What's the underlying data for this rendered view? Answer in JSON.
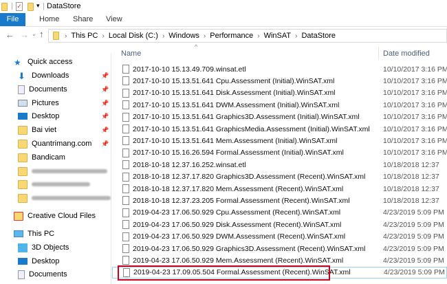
{
  "window": {
    "title": "DataStore"
  },
  "ribbon": {
    "tabs": [
      "File",
      "Home",
      "Share",
      "View"
    ]
  },
  "address": {
    "crumbs": [
      "This PC",
      "Local Disk (C:)",
      "Windows",
      "Performance",
      "WinSAT",
      "DataStore"
    ]
  },
  "columns": {
    "name": "Name",
    "date": "Date modified"
  },
  "nav": {
    "quick_access": "Quick access",
    "pinned": [
      {
        "label": "Downloads",
        "icon": "download-icon"
      },
      {
        "label": "Documents",
        "icon": "documents-icon"
      },
      {
        "label": "Pictures",
        "icon": "pictures-icon"
      },
      {
        "label": "Desktop",
        "icon": "desktop-icon"
      },
      {
        "label": "Bai viet",
        "icon": "folder-icon"
      },
      {
        "label": "Quantrimang.com",
        "icon": "folder-icon"
      }
    ],
    "bandicam": "Bandicam",
    "creative_cloud": "Creative Cloud Files",
    "this_pc": "This PC",
    "pc_items": [
      "3D Objects",
      "Desktop",
      "Documents"
    ]
  },
  "files": [
    {
      "name": "2017-10-10 15.13.49.709.winsat.etl",
      "date": "10/10/2017 3:16 PM"
    },
    {
      "name": "2017-10-10 15.13.51.641 Cpu.Assessment (Initial).WinSAT.xml",
      "date": "10/10/2017 3:16 PM"
    },
    {
      "name": "2017-10-10 15.13.51.641 Disk.Assessment (Initial).WinSAT.xml",
      "date": "10/10/2017 3:16 PM"
    },
    {
      "name": "2017-10-10 15.13.51.641 DWM.Assessment (Initial).WinSAT.xml",
      "date": "10/10/2017 3:16 PM"
    },
    {
      "name": "2017-10-10 15.13.51.641 Graphics3D.Assessment (Initial).WinSAT.xml",
      "date": "10/10/2017 3:16 PM"
    },
    {
      "name": "2017-10-10 15.13.51.641 GraphicsMedia.Assessment (Initial).WinSAT.xml",
      "date": "10/10/2017 3:16 PM"
    },
    {
      "name": "2017-10-10 15.13.51.641 Mem.Assessment (Initial).WinSAT.xml",
      "date": "10/10/2017 3:16 PM"
    },
    {
      "name": "2017-10-10 15.16.26.594 Formal.Assessment (Initial).WinSAT.xml",
      "date": "10/10/2017 3:16 PM"
    },
    {
      "name": "2018-10-18 12.37.16.252.winsat.etl",
      "date": "10/18/2018 12:37"
    },
    {
      "name": "2018-10-18 12.37.17.820 Graphics3D.Assessment (Recent).WinSAT.xml",
      "date": "10/18/2018 12:37"
    },
    {
      "name": "2018-10-18 12.37.17.820 Mem.Assessment (Recent).WinSAT.xml",
      "date": "10/18/2018 12:37"
    },
    {
      "name": "2018-10-18 12.37.23.205 Formal.Assessment (Recent).WinSAT.xml",
      "date": "10/18/2018 12:37"
    },
    {
      "name": "2019-04-23 17.06.50.929 Cpu.Assessment (Recent).WinSAT.xml",
      "date": "4/23/2019 5:09 PM"
    },
    {
      "name": "2019-04-23 17.06.50.929 Disk.Assessment (Recent).WinSAT.xml",
      "date": "4/23/2019 5:09 PM"
    },
    {
      "name": "2019-04-23 17.06.50.929 DWM.Assessment (Recent).WinSAT.xml",
      "date": "4/23/2019 5:09 PM"
    },
    {
      "name": "2019-04-23 17.06.50.929 Graphics3D.Assessment (Recent).WinSAT.xml",
      "date": "4/23/2019 5:09 PM"
    },
    {
      "name": "2019-04-23 17.06.50.929 Mem.Assessment (Recent).WinSAT.xml",
      "date": "4/23/2019 5:09 PM"
    },
    {
      "name": "2019-04-23 17.09.05.504 Formal.Assessment (Recent).WinSAT.xml",
      "date": "4/23/2019 5:09 PM"
    }
  ],
  "colors": {
    "accent": "#1979ca",
    "highlight": "#d0021b",
    "selection": "#99d1ff"
  }
}
